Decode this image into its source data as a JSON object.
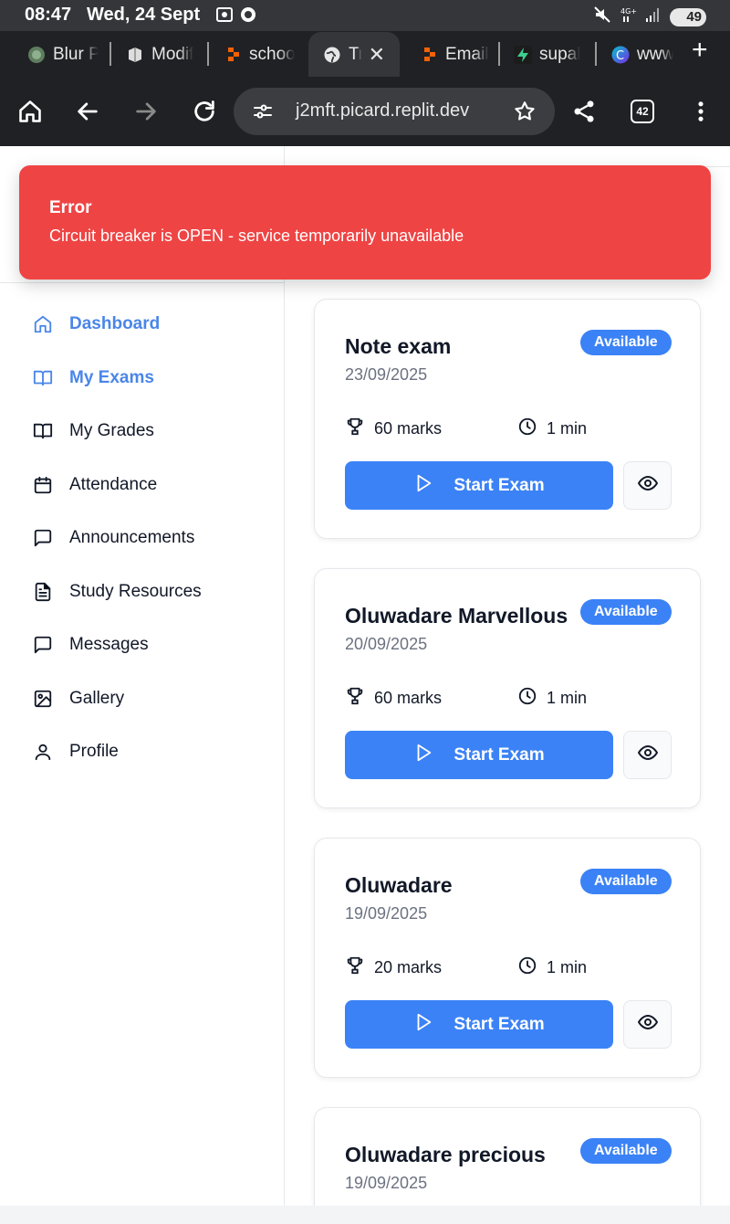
{
  "status_bar": {
    "time": "08:47",
    "date": "Wed, 24 Sept",
    "battery": "49"
  },
  "tabs": [
    {
      "label": "Blur P",
      "icon": "blur-app-icon"
    },
    {
      "label": "Modif",
      "icon": "modify-app-icon"
    },
    {
      "label": "schoo",
      "icon": "replit-icon"
    },
    {
      "label": "Tre",
      "icon": "globe-icon",
      "active": true
    },
    {
      "label": "Email",
      "icon": "replit-icon"
    },
    {
      "label": "supal",
      "icon": "supabase-icon"
    },
    {
      "label": "www",
      "icon": "canva-icon"
    }
  ],
  "toolbar": {
    "url": "j2mft.picard.replit.dev",
    "tab_count": "42"
  },
  "toast": {
    "title": "Error",
    "message": "Circuit breaker is OPEN - service temporarily unavailable",
    "color": "#ef4444"
  },
  "sidebar": {
    "items": [
      {
        "label": "Dashboard",
        "icon": "home-icon",
        "active": true
      },
      {
        "label": "My Exams",
        "icon": "book-open-icon",
        "active": true
      },
      {
        "label": "My Grades",
        "icon": "book-icon"
      },
      {
        "label": "Attendance",
        "icon": "calendar-icon"
      },
      {
        "label": "Announcements",
        "icon": "message-square-icon"
      },
      {
        "label": "Study Resources",
        "icon": "file-text-icon"
      },
      {
        "label": "Messages",
        "icon": "message-square-icon"
      },
      {
        "label": "Gallery",
        "icon": "image-icon"
      },
      {
        "label": "Profile",
        "icon": "user-icon"
      }
    ]
  },
  "exams": [
    {
      "title": "Note exam",
      "date": "23/09/2025",
      "status": "Available",
      "marks": "60 marks",
      "duration": "1 min",
      "action": "Start Exam"
    },
    {
      "title": "Oluwadare Marvellous",
      "date": "20/09/2025",
      "status": "Available",
      "marks": "60 marks",
      "duration": "1 min",
      "action": "Start Exam"
    },
    {
      "title": "Oluwadare",
      "date": "19/09/2025",
      "status": "Available",
      "marks": "20 marks",
      "duration": "1 min",
      "action": "Start Exam"
    },
    {
      "title": "Oluwadare precious",
      "date": "19/09/2025",
      "status": "Available",
      "marks": "",
      "duration": "",
      "action": ""
    }
  ],
  "colors": {
    "accent": "#3b82f6",
    "nav_active": "#4a86e8",
    "error": "#ef4444"
  }
}
